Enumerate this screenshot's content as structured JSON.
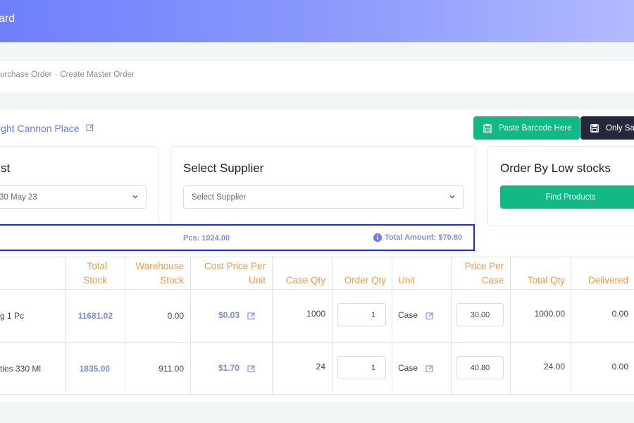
{
  "header": {
    "title": "ard"
  },
  "breadcrumb": {
    "items": [
      "urchase Order",
      "Create Master Order"
    ],
    "separator": "-"
  },
  "store": {
    "name": "ight Cannon Place"
  },
  "actions": {
    "paste_barcode": "Paste Barcode Here",
    "only_save": "Only Sa"
  },
  "date_card": {
    "title": "st",
    "selected": "30 May 23"
  },
  "supplier_card": {
    "title": "Select Supplier",
    "selected": "Select Supplier"
  },
  "low_stock_card": {
    "title": "Order By Low stocks",
    "button": "Find Products"
  },
  "summary": {
    "pcs": "Pcs: 1024.00",
    "total_amount": "Total Amount: $70.80"
  },
  "table": {
    "headers": {
      "total_stock": [
        "Total",
        "Stock"
      ],
      "warehouse_stock": [
        "Warehouse",
        "Stock"
      ],
      "cost_price": [
        "Cost Price Per",
        "Unit"
      ],
      "case_qty": "Case Qty",
      "order_qty": "Order Qty",
      "unit": "Unit",
      "price_per_case": [
        "Price Per",
        "Case"
      ],
      "total_qty": "Total Qty",
      "delivered": "Delivered"
    },
    "rows": [
      {
        "product": "g 1 Pc",
        "total_stock": "11681.02",
        "warehouse_stock": "0.00",
        "cost_price": "$0.03",
        "case_qty": "1000",
        "order_qty": "1",
        "unit": "Case",
        "price_per_case": "30.00",
        "total_qty": "1000.00",
        "delivered": "0.00"
      },
      {
        "product": "tles 330 Ml",
        "total_stock": "1835.00",
        "warehouse_stock": "911.00",
        "cost_price": "$1.70",
        "case_qty": "24",
        "order_qty": "1",
        "unit": "Case",
        "price_per_case": "40.80",
        "total_qty": "24.00",
        "delivered": "0.00"
      }
    ]
  },
  "colors": {
    "accent_blue": "#6a7cf5",
    "green": "#12b886",
    "dark": "#25283b",
    "header_orange": "#f09a3e",
    "highlight_border": "#1d2bd6"
  },
  "icons": [
    "edit-icon",
    "clipboard-icon",
    "save-icon",
    "chevron-down-icon",
    "info-icon"
  ]
}
